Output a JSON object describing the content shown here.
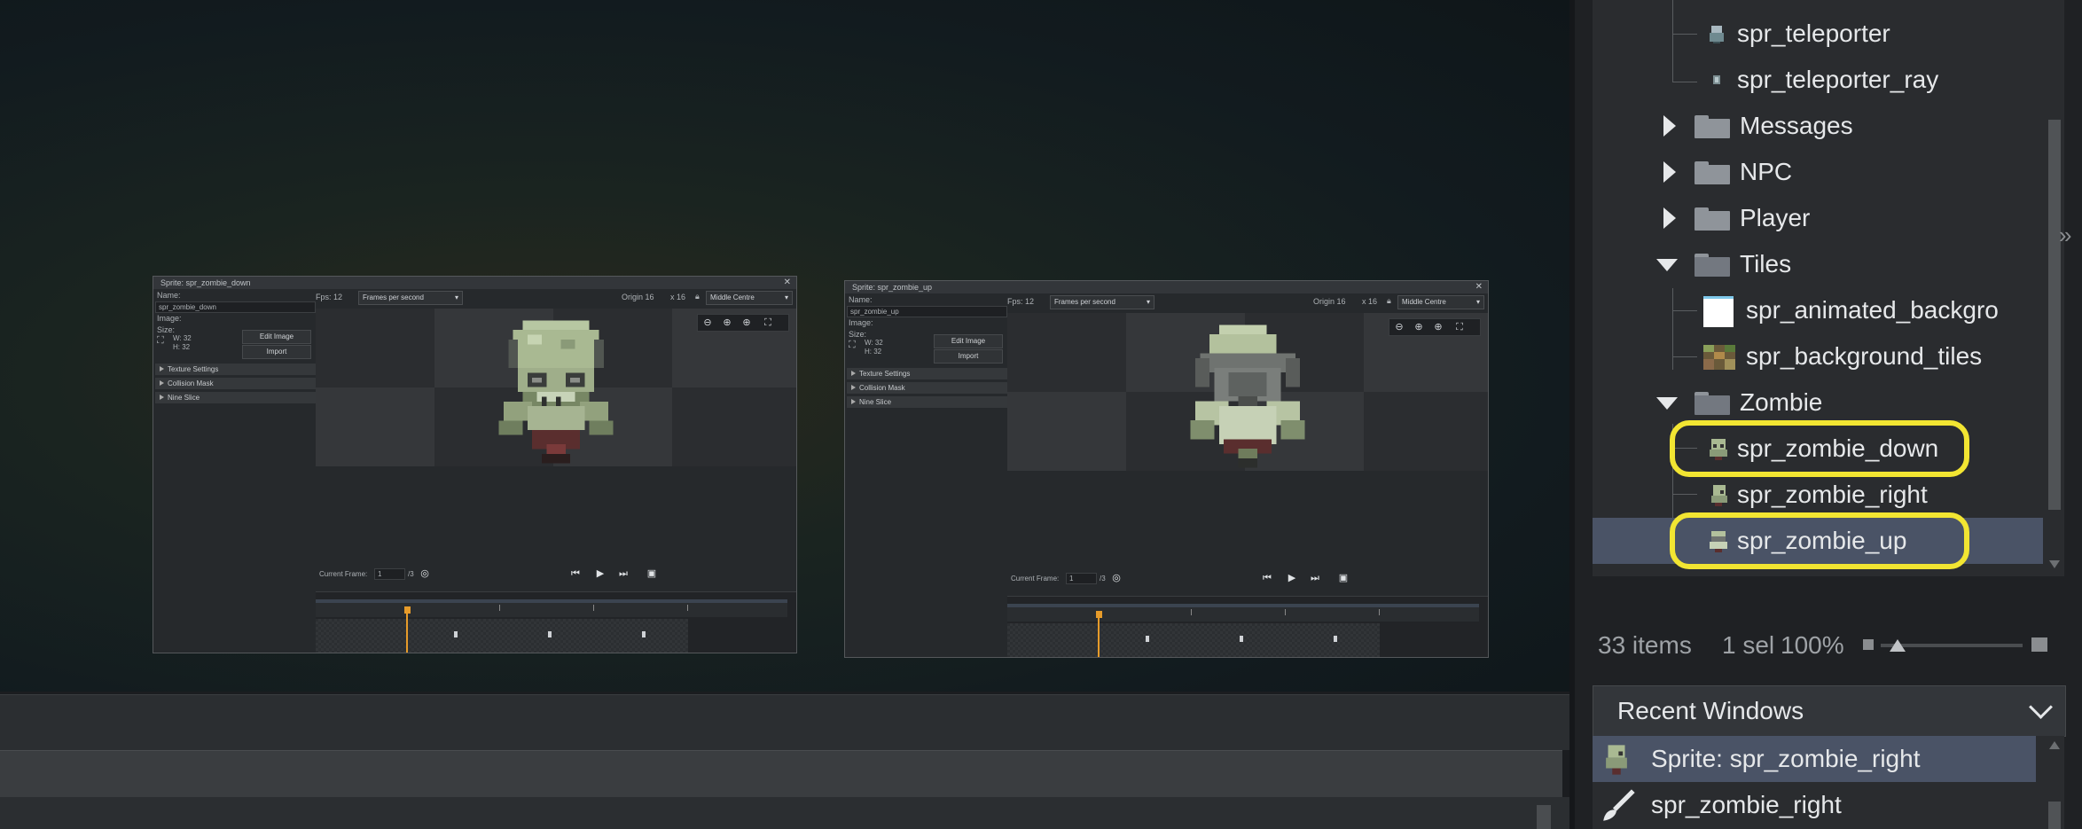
{
  "workspace": {
    "window1": {
      "title": "Sprite: spr_zombie_down",
      "name_label": "Name:",
      "name_value": "spr_zombie_down",
      "image_label": "Image:",
      "size_label": "Size:",
      "width": "W: 32",
      "height": "H: 32",
      "edit_image": "Edit Image",
      "import": "Import",
      "sections": [
        "Texture Settings",
        "Collision Mask",
        "Nine Slice"
      ],
      "fps_label": "Fps: 12",
      "fps_mode": "Frames per second",
      "origin_label": "Origin 16",
      "origin_y": "x 16",
      "origin_preset": "Middle Centre",
      "current_frame_label": "Current Frame:",
      "current_frame_value": "1",
      "frame_total": "/3"
    },
    "window2": {
      "title": "Sprite: spr_zombie_up",
      "name_label": "Name:",
      "name_value": "spr_zombie_up",
      "image_label": "Image:",
      "size_label": "Size:",
      "width": "W: 32",
      "height": "H: 32",
      "edit_image": "Edit Image",
      "import": "Import",
      "sections": [
        "Texture Settings",
        "Collision Mask",
        "Nine Slice"
      ],
      "fps_label": "Fps: 12",
      "fps_mode": "Frames per second",
      "origin_label": "Origin 16",
      "origin_y": "x 16",
      "origin_preset": "Middle Centre",
      "current_frame_label": "Current Frame:",
      "current_frame_value": "1",
      "frame_total": "/3"
    }
  },
  "asset_browser": {
    "items": [
      {
        "label": "spr_teleporter",
        "type": "sprite"
      },
      {
        "label": "spr_teleporter_ray",
        "type": "sprite"
      },
      {
        "label": "Messages",
        "type": "folder-collapsed"
      },
      {
        "label": "NPC",
        "type": "folder-collapsed"
      },
      {
        "label": "Player",
        "type": "folder-collapsed"
      },
      {
        "label": "Tiles",
        "type": "folder-expanded"
      },
      {
        "label": "spr_animated_backgro",
        "type": "sprite"
      },
      {
        "label": "spr_background_tiles",
        "type": "sprite"
      },
      {
        "label": "Zombie",
        "type": "folder-expanded"
      },
      {
        "label": "spr_zombie_down",
        "type": "sprite"
      },
      {
        "label": "spr_zombie_right",
        "type": "sprite"
      },
      {
        "label": "spr_zombie_up",
        "type": "sprite"
      }
    ],
    "status": {
      "count": "33 items",
      "selected": "1 sel",
      "zoom": "100%"
    }
  },
  "recent_windows": {
    "title": "Recent Windows",
    "items": [
      {
        "label": "Sprite: spr_zombie_right"
      },
      {
        "label": "spr_zombie_right"
      }
    ]
  },
  "colors": {
    "highlight": "#f2e532",
    "selection": "#4a5366",
    "playhead": "#e69b2a"
  }
}
